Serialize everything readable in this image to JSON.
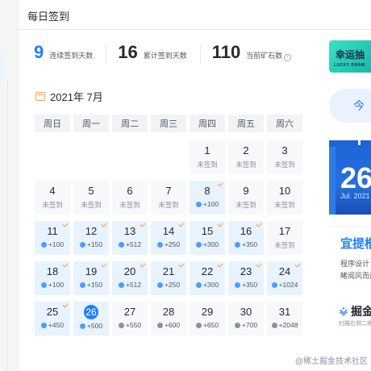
{
  "page": {
    "title": "每日签到"
  },
  "stats": [
    {
      "value": "9",
      "label": "连续签到天数",
      "color": "#1e80ff"
    },
    {
      "value": "16",
      "label": "累计签到天数",
      "color": "#252933"
    },
    {
      "value": "110",
      "label": "当前矿石数",
      "color": "#252933",
      "has_info": true,
      "info_glyph": "i"
    }
  ],
  "calendar": {
    "month_label": "2021年 7月",
    "weekdays": [
      "周日",
      "周一",
      "周二",
      "周三",
      "周四",
      "周五",
      "周六"
    ],
    "days": [
      {
        "n": "1",
        "status": "未签到",
        "signed": false,
        "checked": false
      },
      {
        "n": "2",
        "status": "未签到",
        "signed": false,
        "checked": false
      },
      {
        "n": "3",
        "status": "未签到",
        "signed": false,
        "checked": false
      },
      {
        "n": "4",
        "status": "未签到",
        "signed": false,
        "checked": false
      },
      {
        "n": "5",
        "status": "未签到",
        "signed": false,
        "checked": false
      },
      {
        "n": "6",
        "status": "未签到",
        "signed": false,
        "checked": false
      },
      {
        "n": "7",
        "status": "未签到",
        "signed": false,
        "checked": false
      },
      {
        "n": "8",
        "status": "+100",
        "signed": true,
        "checked": true
      },
      {
        "n": "9",
        "status": "未签到",
        "signed": false,
        "checked": false
      },
      {
        "n": "10",
        "status": "未签到",
        "signed": false,
        "checked": false
      },
      {
        "n": "11",
        "status": "+100",
        "signed": true,
        "checked": true
      },
      {
        "n": "12",
        "status": "+150",
        "signed": true,
        "checked": true
      },
      {
        "n": "13",
        "status": "+512",
        "signed": true,
        "checked": true
      },
      {
        "n": "14",
        "status": "+250",
        "signed": true,
        "checked": true
      },
      {
        "n": "15",
        "status": "+300",
        "signed": true,
        "checked": true
      },
      {
        "n": "16",
        "status": "+350",
        "signed": true,
        "checked": true
      },
      {
        "n": "17",
        "status": "未签到",
        "signed": false,
        "checked": false
      },
      {
        "n": "18",
        "status": "+100",
        "signed": true,
        "checked": true
      },
      {
        "n": "19",
        "status": "+150",
        "signed": true,
        "checked": true
      },
      {
        "n": "20",
        "status": "+512",
        "signed": true,
        "checked": true
      },
      {
        "n": "21",
        "status": "+250",
        "signed": true,
        "checked": true
      },
      {
        "n": "22",
        "status": "+300",
        "signed": true,
        "checked": true
      },
      {
        "n": "23",
        "status": "+350",
        "signed": true,
        "checked": true
      },
      {
        "n": "24",
        "status": "+1024",
        "signed": true,
        "checked": true
      },
      {
        "n": "25",
        "status": "+450",
        "signed": true,
        "checked": true
      },
      {
        "n": "26",
        "status": "+500",
        "signed": true,
        "checked": false,
        "today": true
      },
      {
        "n": "27",
        "status": "+550",
        "signed": false,
        "checked": false,
        "future": true
      },
      {
        "n": "28",
        "status": "+600",
        "signed": false,
        "checked": false,
        "future": true
      },
      {
        "n": "29",
        "status": "+650",
        "signed": false,
        "checked": false,
        "future": true
      },
      {
        "n": "30",
        "status": "+700",
        "signed": false,
        "checked": false,
        "future": true
      },
      {
        "n": "31",
        "status": "+2048",
        "signed": false,
        "checked": false,
        "future": true
      }
    ]
  },
  "right_panel": {
    "lottery_title": "幸运抽",
    "lottery_sub": "LUCKY DRAW",
    "today_button": "今",
    "promo_big": "26",
    "promo_date": "Jul. 2021",
    "wechat_title": "宜提楷",
    "wechat_line1": "程序设计",
    "wechat_line2": "睹阅风而边",
    "juejin_logo": "掘金",
    "juejin_scan": "扫描右侧二维"
  },
  "watermark": "@稀土掘金技术社区",
  "colors": {
    "accent": "#1e80ff",
    "check": "#ff9a2e",
    "signed_bg": "#e8f3ff"
  }
}
